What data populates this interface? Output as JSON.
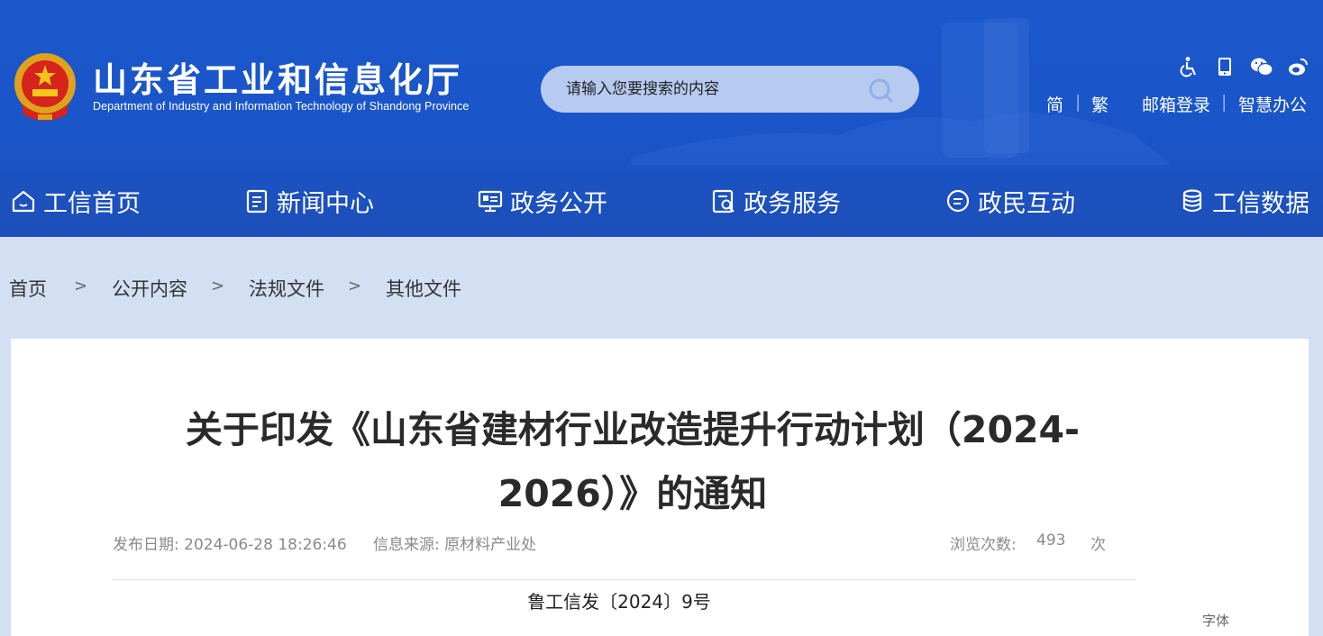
{
  "header": {
    "title": "山东省工业和信息化厅",
    "subtitle": "Department of Industry and Information Technology of Shandong Province",
    "emblem_icon": "national-emblem-icon",
    "search": {
      "placeholder": "请输入您要搜索的内容",
      "icon": "search-icon"
    },
    "tools": [
      "accessibility-icon",
      "mobile-icon",
      "wechat-icon",
      "weibo-icon"
    ],
    "links": {
      "simplified": "简",
      "traditional": "繁",
      "mail_login": "邮箱登录",
      "smart_office": "智慧办公",
      "separator": "|"
    }
  },
  "nav": [
    {
      "label": "工信首页",
      "icon": "home-icon"
    },
    {
      "label": "新闻中心",
      "icon": "news-icon"
    },
    {
      "label": "政务公开",
      "icon": "screen-icon"
    },
    {
      "label": "政务服务",
      "icon": "service-icon"
    },
    {
      "label": "政民互动",
      "icon": "chat-icon"
    },
    {
      "label": "工信数据",
      "icon": "database-icon"
    }
  ],
  "breadcrumb": {
    "items": [
      "首页",
      "公开内容",
      "法规文件",
      "其他文件"
    ],
    "separator": ">"
  },
  "article": {
    "title_line1": "关于印发《山东省建材行业改造提升行动计划（2024-",
    "title_line2": "2026）》的通知",
    "publish_date": "发布日期: 2024-06-28 18:26:46",
    "source": "信息来源: 原材料产业处",
    "views_label": "浏览次数:",
    "views_count": "493",
    "views_unit": "次",
    "doc_number": "鲁工信发〔2024〕9号",
    "font_label": "字体"
  },
  "colors": {
    "header_blue": "#1a55c8",
    "page_bg": "#d3dff3",
    "title_text": "#2a2a2a",
    "meta_text": "#8a8a8a"
  }
}
